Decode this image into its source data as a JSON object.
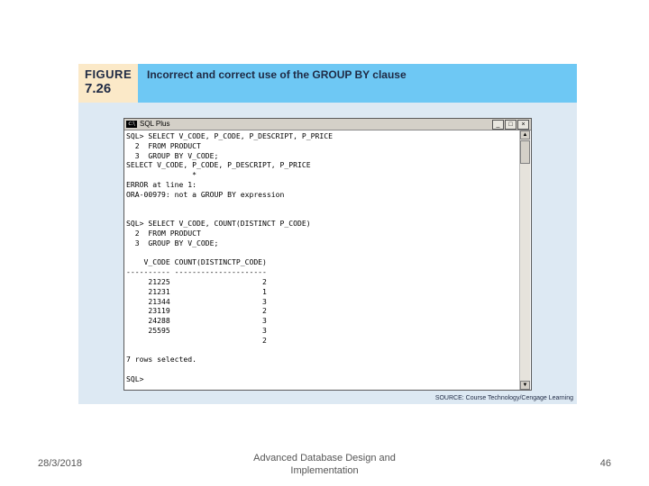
{
  "figure": {
    "label_word": "FIGURE",
    "label_number": "7.26",
    "caption": "Incorrect and correct use of the GROUP BY clause",
    "source": "SOURCE: Course Technology/Cengage Learning"
  },
  "window": {
    "title": "SQL Plus",
    "icon_text": "c:\\",
    "minimize": "_",
    "maximize": "□",
    "close": "×",
    "scroll_up": "▲",
    "scroll_down": "▼"
  },
  "console_lines": [
    "SQL> SELECT V_CODE, P_CODE, P_DESCRIPT, P_PRICE",
    "  2  FROM PRODUCT",
    "  3  GROUP BY V_CODE;",
    "SELECT V_CODE, P_CODE, P_DESCRIPT, P_PRICE",
    "               *",
    "ERROR at line 1:",
    "ORA-00979: not a GROUP BY expression",
    "",
    "",
    "SQL> SELECT V_CODE, COUNT(DISTINCT P_CODE)",
    "  2  FROM PRODUCT",
    "  3  GROUP BY V_CODE;",
    "",
    "    V_CODE COUNT(DISTINCTP_CODE)",
    "---------- ---------------------",
    "     21225                     2",
    "     21231                     1",
    "     21344                     3",
    "     23119                     2",
    "     24288                     3",
    "     25595                     3",
    "                               2",
    "",
    "7 rows selected.",
    "",
    "SQL>"
  ],
  "footer": {
    "date": "28/3/2018",
    "title": "Advanced Database Design and Implementation",
    "page": "46"
  }
}
